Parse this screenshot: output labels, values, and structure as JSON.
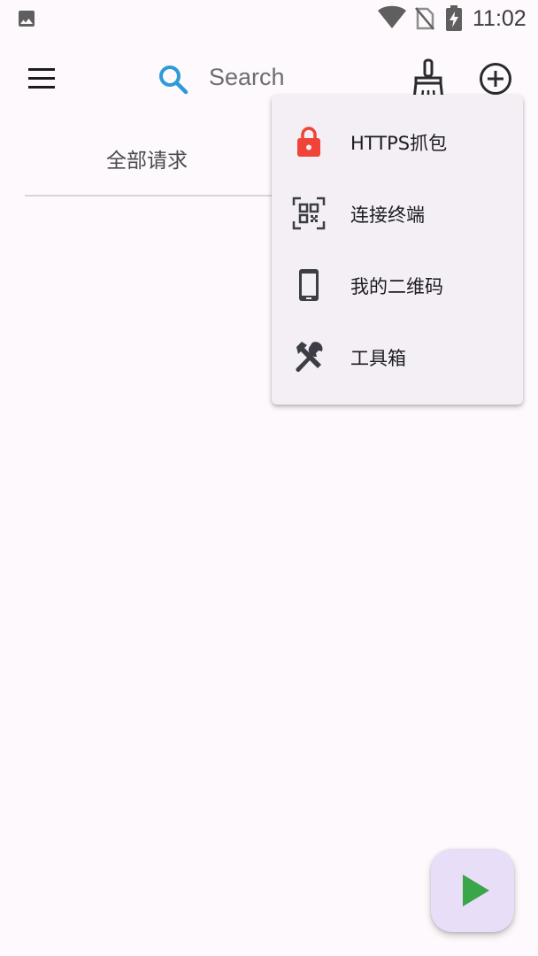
{
  "status_bar": {
    "time": "11:02",
    "icons": [
      "image-icon",
      "wifi-icon",
      "no-sim-icon",
      "battery-charging-icon"
    ]
  },
  "toolbar": {
    "menu_icon": "hamburger-menu-icon",
    "search_placeholder": "Search",
    "search_icon": "search-icon",
    "clean_icon": "broom-icon",
    "add_icon": "add-circle-icon",
    "accent_color": "#2f9bd6"
  },
  "tabs": {
    "items": [
      {
        "label": "全部请求"
      }
    ]
  },
  "popup_menu": {
    "items": [
      {
        "label": "HTTPS抓包",
        "icon": "lock-icon",
        "icon_color": "#f04438"
      },
      {
        "label": "连接终端",
        "icon": "qr-scan-icon",
        "icon_color": "#3d3d45"
      },
      {
        "label": "我的二维码",
        "icon": "phone-icon",
        "icon_color": "#3d3d45"
      },
      {
        "label": "工具箱",
        "icon": "tools-icon",
        "icon_color": "#3d3d45"
      }
    ]
  },
  "fab": {
    "icon": "play-icon",
    "icon_color": "#3aa64a",
    "background": "#e8def8"
  }
}
